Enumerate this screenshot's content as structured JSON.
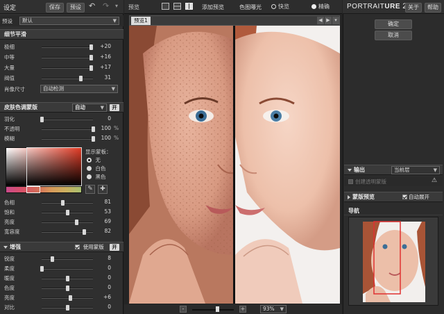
{
  "left": {
    "title": "设定",
    "save_label": "保存",
    "presets_label": "预设",
    "preset_label": "预设",
    "preset_value": "默认",
    "detail": {
      "title": "细节平滑",
      "sliders": [
        {
          "label": "极细",
          "value": "+20",
          "level": 0.96
        },
        {
          "label": "中等",
          "value": "+16",
          "level": 0.96
        },
        {
          "label": "大量",
          "value": "+17",
          "level": 0.96
        },
        {
          "label": "阀值",
          "value": "31",
          "level": 0.75
        }
      ],
      "size_label": "肖像尺寸",
      "size_value": "自动检测"
    },
    "mask": {
      "title": "皮肤色调蒙版",
      "mode_value": "自动",
      "on_label": "开",
      "sliders": [
        {
          "label": "羽化",
          "value": "0",
          "unit": "",
          "level": 0.0
        },
        {
          "label": "不透明",
          "value": "100",
          "unit": "%",
          "level": 1.0
        },
        {
          "label": "模糊",
          "value": "100",
          "unit": "%",
          "level": 1.0
        }
      ],
      "show_mask_label": "显示蒙板：",
      "radios": [
        {
          "label": "无",
          "selected": true
        },
        {
          "label": "白色",
          "selected": false
        },
        {
          "label": "黑色",
          "selected": false
        }
      ],
      "color_sliders": [
        {
          "label": "色相",
          "value": "81",
          "level": 0.4
        },
        {
          "label": "饱和",
          "value": "53",
          "level": 0.5
        },
        {
          "label": "亮度",
          "value": "69",
          "level": 0.68
        },
        {
          "label": "宽容度",
          "value": "82",
          "level": 0.82
        }
      ]
    },
    "enhance": {
      "title": "增强",
      "use_mask_label": "使用蒙版",
      "on_label": "开",
      "sliders": [
        {
          "label": "锐度",
          "value": "8",
          "level": 0.2
        },
        {
          "label": "柔度",
          "value": "0",
          "level": 0.0
        },
        {
          "label": "暖度",
          "value": "0",
          "level": 0.5
        },
        {
          "label": "色度",
          "value": "0",
          "level": 0.5
        },
        {
          "label": "亮度",
          "value": "+6",
          "level": 0.56
        },
        {
          "label": "对比",
          "value": "0",
          "level": 0.5
        }
      ]
    }
  },
  "toolbar": {
    "preview_label": "预览",
    "add_preview_label": "添加预览",
    "clip_label": "色图曝光",
    "fast_label": "快览",
    "fine_label": "精确",
    "tab_label": "预览1",
    "zoom_value": "93%"
  },
  "right": {
    "brand_a": "Portrait",
    "brand_b": "ure",
    "brand_version": "2",
    "about_label": "关于",
    "help_label": "帮助",
    "ok_label": "确定",
    "cancel_label": "取消",
    "output_label": "输出",
    "output_value": "当前层",
    "output_checkbox_label": "创建透明蒙版",
    "mask_preview_label": "蒙版预览",
    "auto_expand_label": "自动展开",
    "navigator_label": "导航"
  },
  "colors": {
    "accent_on": "#d8d8d8",
    "nav_frame": "#e03030"
  }
}
